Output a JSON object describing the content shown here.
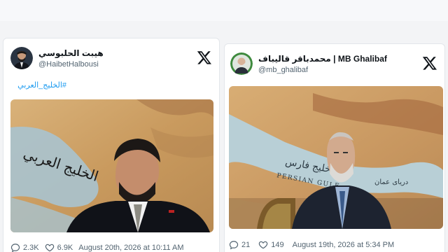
{
  "colors": {
    "link": "#1d9bf0",
    "text": "#0f1419",
    "muted": "#536471",
    "card_bg": "#ffffff",
    "page_bg": "#f3f4f6"
  },
  "posts": [
    {
      "display_name": "هيبت الحلبوسي",
      "handle": "@HaibetHalbousi",
      "brand_icon": "x-logo-icon",
      "hashtag": "#الخليج_العربي",
      "image_caption": "الخليج العربي",
      "image_description": "man-in-suit-over-gulf-map",
      "reply_icon": "comment-icon",
      "like_icon": "heart-icon",
      "replies": "2.3K",
      "likes": "6.9K",
      "timestamp": "August 20th, 2026 at 10:11 AM"
    },
    {
      "display_name": "محمدباقر قالیباف | MB Ghalibaf",
      "handle": "@mb_ghalibaf",
      "brand_icon": "x-logo-icon",
      "image_caption": "خلیج فارس",
      "image_caption_2": "PERSIAN GULF",
      "image_caption_3": "دریای عمان",
      "image_description": "man-seated-before-persian-gulf-map",
      "reply_icon": "comment-icon",
      "like_icon": "heart-icon",
      "replies": "21",
      "likes": "149",
      "timestamp": "August 19th, 2026 at 5:34 PM"
    }
  ]
}
